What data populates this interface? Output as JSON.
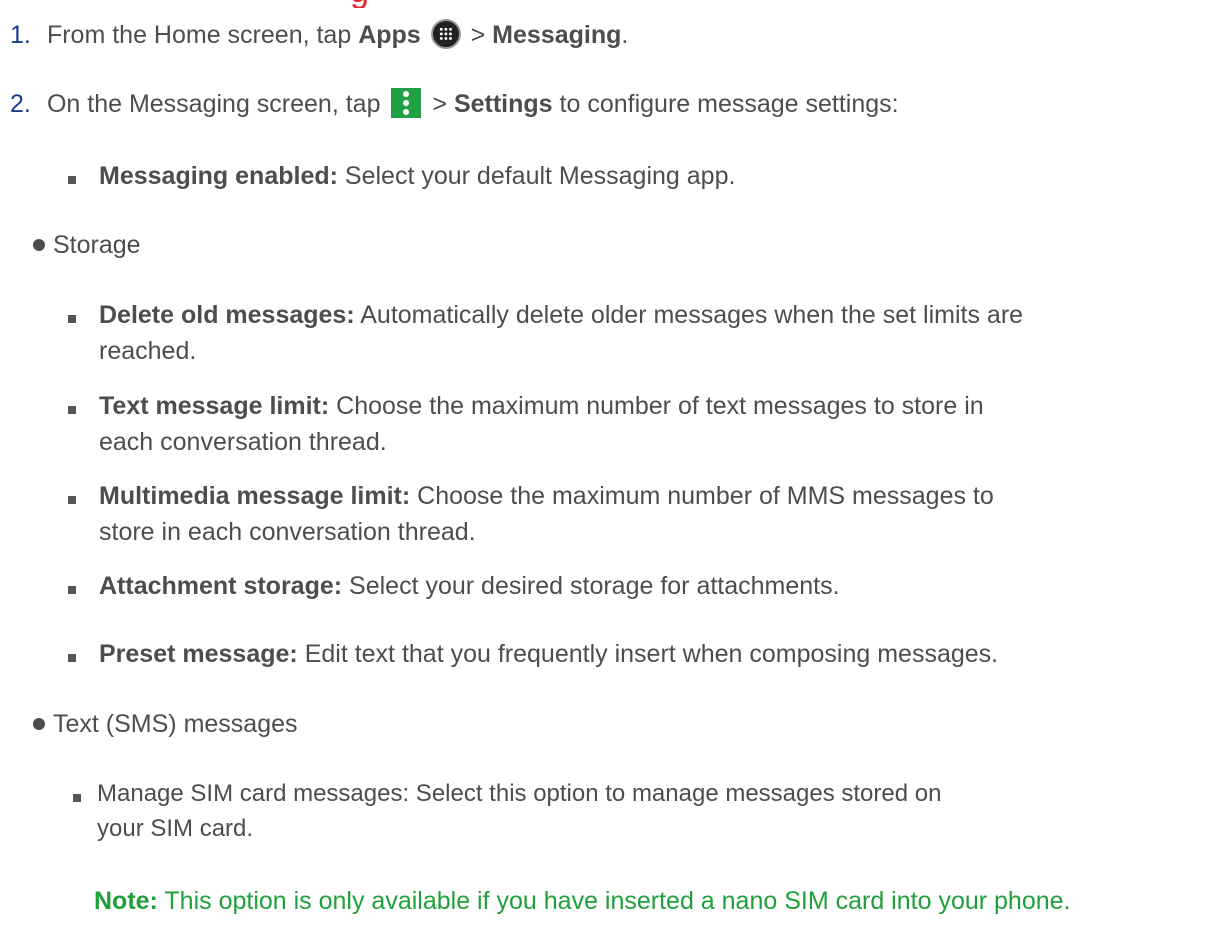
{
  "top_fragment": "g",
  "step1": {
    "number": "1.",
    "before": "From the Home screen, tap",
    "apps": "Apps",
    "gt": ">",
    "messaging": "Messaging",
    "end": "."
  },
  "step2": {
    "number": "2.",
    "before": "On the Messaging screen, tap",
    "gt": ">",
    "settings": "Settings",
    "after": "to configure message settings:"
  },
  "items": {
    "messaging_enabled": {
      "term": "Messaging enabled:",
      "desc": "Select your default Messaging app."
    },
    "delete_old": {
      "term": "Delete old messages:",
      "desc_line1": "Automatically delete older messages when the set limits are",
      "desc_line2": "reached."
    },
    "text_limit": {
      "term": "Text message limit:",
      "desc_line1": "Choose the maximum number of text messages to store in",
      "desc_line2": "each conversation thread."
    },
    "mms_limit": {
      "term": "Multimedia message limit:",
      "desc_line1": "Choose the maximum number of MMS messages to",
      "desc_line2": "store in each conversation thread."
    },
    "attachment": {
      "term": "Attachment storage:",
      "desc": "Select your desired storage for attachments."
    },
    "preset": {
      "term": "Preset message:",
      "desc": "Edit text that you frequently insert when composing messages."
    },
    "sim": {
      "line1": "Manage SIM card messages: Select this option to manage messages stored on",
      "line2": "your SIM card."
    }
  },
  "sections": {
    "storage": "Storage",
    "sms": "Text (SMS) messages"
  },
  "note": {
    "label": "Note:",
    "text": "This option is only available if you have inserted a nano SIM card into your phone."
  },
  "icons": {
    "apps": "apps-grid-icon",
    "menu": "overflow-menu-icon"
  },
  "colors": {
    "body_text": "#4d4d4d",
    "step_number": "#1a3c8c",
    "heading_red": "#e8232f",
    "note_green": "#1fa03a",
    "menu_icon_bg": "#21a046"
  }
}
